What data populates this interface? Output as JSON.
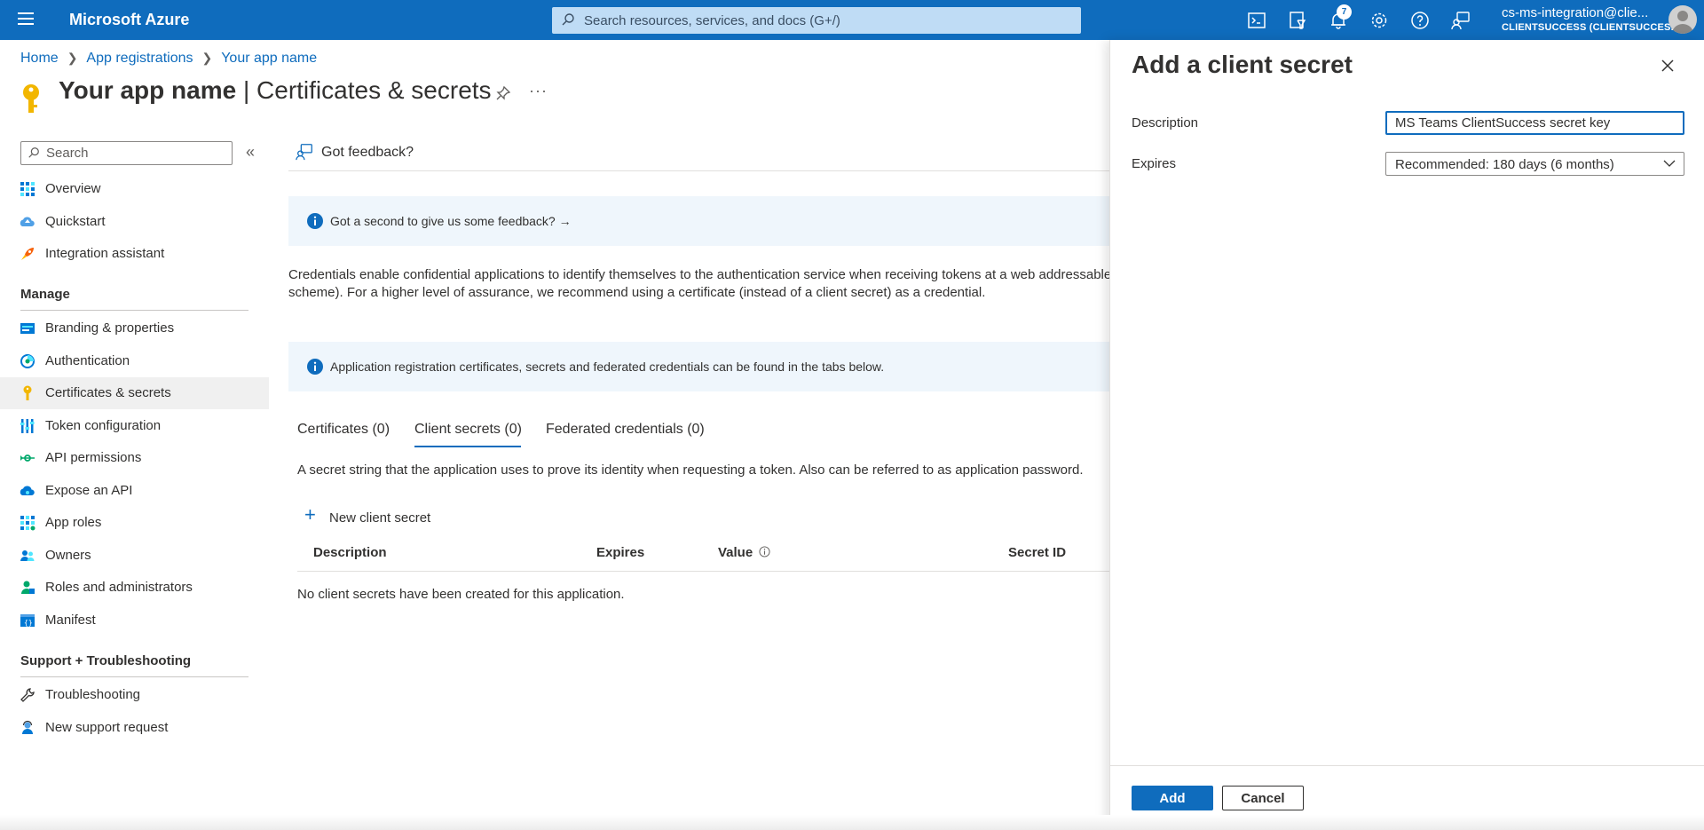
{
  "topbar": {
    "brand": "Microsoft Azure",
    "search_placeholder": "Search resources, services, and docs (G+/)",
    "notification_count": "7",
    "account_email": "cs-ms-integration@clie...",
    "account_tenant": "CLIENTSUCCESS (CLIENTSUCCES..."
  },
  "breadcrumb": [
    "Home",
    "App registrations",
    "Your app name"
  ],
  "page": {
    "title_app": "Your app name",
    "title_sep": " | ",
    "title_section": "Certificates & secrets",
    "more": "···"
  },
  "nav": {
    "search_placeholder": "Search",
    "collapse": "«",
    "items_top": [
      {
        "label": "Overview",
        "icon": "overview-icon"
      },
      {
        "label": "Quickstart",
        "icon": "quickstart-icon"
      },
      {
        "label": "Integration assistant",
        "icon": "rocket-icon"
      }
    ],
    "manage_heading": "Manage",
    "manage_items": [
      {
        "label": "Branding & properties",
        "icon": "branding-icon"
      },
      {
        "label": "Authentication",
        "icon": "authentication-icon"
      },
      {
        "label": "Certificates & secrets",
        "icon": "key-icon",
        "selected": true
      },
      {
        "label": "Token configuration",
        "icon": "token-icon"
      },
      {
        "label": "API permissions",
        "icon": "api-permissions-icon"
      },
      {
        "label": "Expose an API",
        "icon": "cloud-icon"
      },
      {
        "label": "App roles",
        "icon": "app-roles-icon"
      },
      {
        "label": "Owners",
        "icon": "owners-icon"
      },
      {
        "label": "Roles and administrators",
        "icon": "roles-icon"
      },
      {
        "label": "Manifest",
        "icon": "manifest-icon"
      }
    ],
    "support_heading": "Support + Troubleshooting",
    "support_items": [
      {
        "label": "Troubleshooting",
        "icon": "wrench-icon"
      },
      {
        "label": "New support request",
        "icon": "support-person-icon"
      }
    ]
  },
  "main": {
    "feedback_label": "Got feedback?",
    "feedback_banner": "Got a second to give us some feedback? →",
    "description_line1": "Credentials enable confidential applications to identify themselves to the authentication service when receiving tokens at a web addressable lo",
    "description_line2": "scheme). For a higher level of assurance, we recommend using a certificate (instead of a client secret) as a credential.",
    "info_banner": "Application registration certificates, secrets and federated credentials can be found in the tabs below.",
    "tabs": [
      "Certificates (0)",
      "Client secrets (0)",
      "Federated credentials (0)"
    ],
    "active_tab": 1,
    "secret_description": "A secret string that the application uses to prove its identity when requesting a token. Also can be referred to as application password.",
    "new_secret_label": "New client secret",
    "table_headers": [
      "Description",
      "Expires",
      "Value",
      "Secret ID"
    ],
    "empty_message": "No client secrets have been created for this application."
  },
  "panel": {
    "title": "Add a client secret",
    "description_label": "Description",
    "description_value": "MS Teams ClientSuccess secret key",
    "expires_label": "Expires",
    "expires_value": "Recommended: 180 days (6 months)",
    "add_label": "Add",
    "cancel_label": "Cancel"
  },
  "colors": {
    "brand_blue": "#0f6cbd",
    "banner_bg": "#eff6fc",
    "key_yellow": "#f2b600"
  }
}
